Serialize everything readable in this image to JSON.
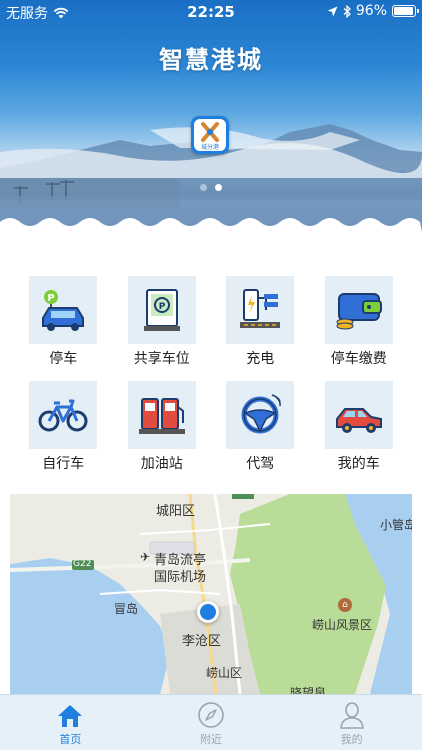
{
  "status_bar": {
    "carrier": "无服务",
    "time": "22:25",
    "battery": "96%",
    "battery_level": 0.96
  },
  "banner": {
    "title": "智慧港城",
    "logo_text": "城分港",
    "page_count": 2,
    "active_page": 1
  },
  "services": [
    {
      "label": "停车",
      "icon": "parking-car-icon"
    },
    {
      "label": "共享车位",
      "icon": "shared-parking-icon"
    },
    {
      "label": "充电",
      "icon": "charging-icon"
    },
    {
      "label": "停车缴费",
      "icon": "wallet-icon"
    },
    {
      "label": "自行车",
      "icon": "bicycle-icon"
    },
    {
      "label": "加油站",
      "icon": "gas-station-icon"
    },
    {
      "label": "代驾",
      "icon": "steering-wheel-icon"
    },
    {
      "label": "我的车",
      "icon": "my-car-icon"
    }
  ],
  "map": {
    "labels": {
      "chengyang": "城阳区",
      "xiaoguan": "小管岛",
      "road": "G22",
      "airport": "青岛流亭",
      "airport2": "国际机场",
      "maodao": "冒岛",
      "licang": "李沧区",
      "laoshan_scenic": "崂山风景区",
      "laoshan": "崂山区",
      "bottom_partial": "晓望泉"
    }
  },
  "tabs": [
    {
      "label": "首页",
      "icon": "home-icon",
      "active": true
    },
    {
      "label": "附近",
      "icon": "compass-icon",
      "active": false
    },
    {
      "label": "我的",
      "icon": "user-icon",
      "active": false
    }
  ],
  "colors": {
    "accent": "#1f7fe0",
    "tile_bg": "#e4eef6",
    "tab_inactive": "#9aa4ad"
  }
}
